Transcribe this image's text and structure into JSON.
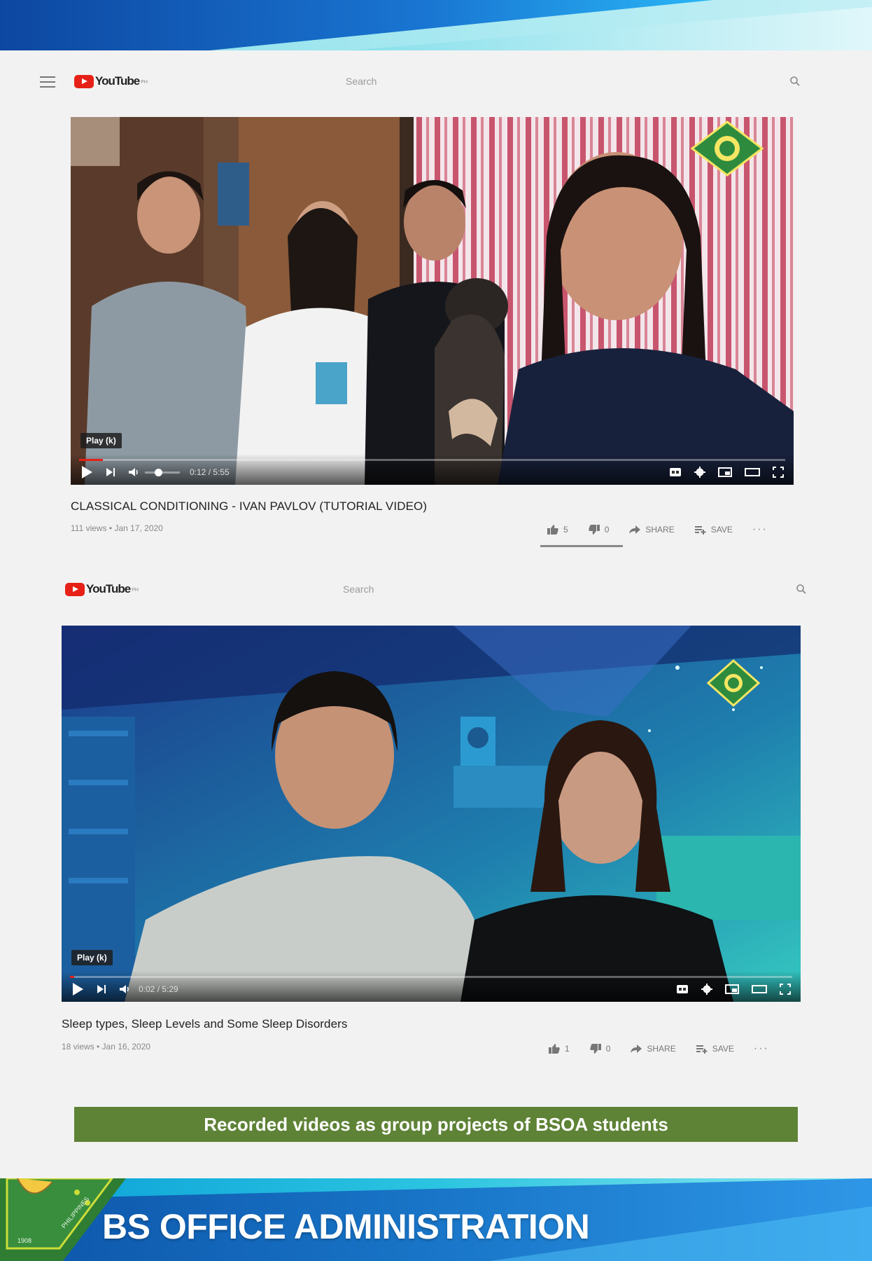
{
  "colors": {
    "youtube_red": "#e62117",
    "caption_green": "#5e8236",
    "banner_blue": "#1565c0",
    "banner_cyan": "#3fd6e6"
  },
  "videos": [
    {
      "header": {
        "logo_text": "YouTube",
        "logo_region": "PH",
        "search_placeholder": "Search",
        "icons": [
          "menu-icon",
          "search-icon"
        ]
      },
      "player": {
        "tooltip": "Play (k)",
        "time": "0:12 / 5:55",
        "progress": 0.034
      },
      "title": "CLASSICAL CONDITIONING - IVAN PAVLOV (TUTORIAL VIDEO)",
      "meta": "111 views • Jan 17, 2020",
      "likes": "5",
      "dislikes": "0",
      "share_label": "SHARE",
      "save_label": "SAVE"
    },
    {
      "header": {
        "logo_text": "YouTube",
        "logo_region": "PH",
        "search_placeholder": "Search",
        "icons": [
          "search-icon"
        ]
      },
      "player": {
        "tooltip": "Play (k)",
        "time": "0:02 / 5:29",
        "progress": 0.006
      },
      "title": "Sleep types, Sleep Levels and Some Sleep Disorders",
      "meta": "18 views • Jan 16, 2020",
      "likes": "1",
      "dislikes": "0",
      "share_label": "SHARE",
      "save_label": "SAVE"
    }
  ],
  "caption": "Recorded videos as group projects of BSOA students",
  "banner": {
    "title": "BS OFFICE ADMINISTRATION",
    "seal_text": "PHILIPPINES",
    "seal_year": "1908"
  }
}
